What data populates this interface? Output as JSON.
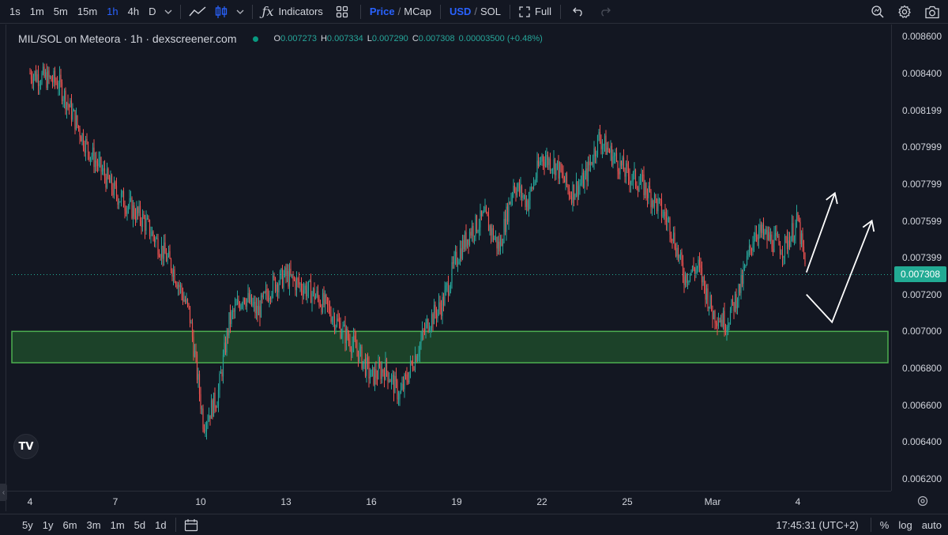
{
  "toolbar": {
    "intervals": [
      "1s",
      "1m",
      "5m",
      "15m",
      "1h",
      "4h",
      "D"
    ],
    "active_interval": "1h",
    "indicators_label": "Indicators",
    "price_label": "Price",
    "mcap_label": "MCap",
    "usd_label": "USD",
    "sol_label": "SOL",
    "slash": "/",
    "full_label": "Full"
  },
  "legend": {
    "title": "MIL/SOL on Meteora · 1h · dexscreener.com",
    "o_key": "O",
    "o_val": "0.007273",
    "h_key": "H",
    "h_val": "0.007334",
    "l_key": "L",
    "l_val": "0.007290",
    "c_key": "C",
    "c_val": "0.007308",
    "change": "0.00003500 (+0.48%)"
  },
  "bottom_bar": {
    "ranges": [
      "5y",
      "1y",
      "6m",
      "3m",
      "1m",
      "5d",
      "1d"
    ],
    "clock": "17:45:31 (UTC+2)",
    "percent_label": "%",
    "log_label": "log",
    "auto_label": "auto"
  },
  "colors": {
    "background": "#131722",
    "up": "#26a69a",
    "down": "#ef5350",
    "zone_fill": "#1f4a2a",
    "zone_border": "#4caf50",
    "price_tag": "#22ab94"
  },
  "chart_data": {
    "type": "candlestick",
    "pair": "MIL/SOL",
    "interval": "1h",
    "price_axis_ticks": [
      "0.008600",
      "0.008400",
      "0.008199",
      "0.007999",
      "0.007799",
      "0.007599",
      "0.007399",
      "0.007200",
      "0.007000",
      "0.006800",
      "0.006600",
      "0.006400",
      "0.006200"
    ],
    "ylim": [
      0.0062,
      0.0086
    ],
    "time_axis_ticks": [
      "4",
      "7",
      "10",
      "13",
      "16",
      "19",
      "22",
      "25",
      "Mar",
      "4"
    ],
    "last_price": "0.007308",
    "support_zone": [
      0.00683,
      0.007
    ],
    "price_path": [
      [
        0,
        0.0084
      ],
      [
        1,
        0.00835
      ],
      [
        2,
        0.008
      ],
      [
        3,
        0.00775
      ],
      [
        4,
        0.0076
      ],
      [
        5,
        0.00735
      ],
      [
        5.6,
        0.0071
      ],
      [
        6.1,
        0.0065
      ],
      [
        6.6,
        0.00665
      ],
      [
        7,
        0.00705
      ],
      [
        7.5,
        0.0072
      ],
      [
        8,
        0.0071
      ],
      [
        8.5,
        0.00725
      ],
      [
        9,
        0.0073
      ],
      [
        9.5,
        0.00725
      ],
      [
        10,
        0.0072
      ],
      [
        10.5,
        0.00712
      ],
      [
        11,
        0.007
      ],
      [
        11.5,
        0.0069
      ],
      [
        12,
        0.00675
      ],
      [
        12.5,
        0.0068
      ],
      [
        13,
        0.00665
      ],
      [
        13.5,
        0.00685
      ],
      [
        14,
        0.00705
      ],
      [
        14.5,
        0.00715
      ],
      [
        15,
        0.0074
      ],
      [
        15.5,
        0.00755
      ],
      [
        16,
        0.00762
      ],
      [
        16.5,
        0.00745
      ],
      [
        17,
        0.0078
      ],
      [
        17.5,
        0.0077
      ],
      [
        18,
        0.00795
      ],
      [
        18.5,
        0.0079
      ],
      [
        19,
        0.00775
      ],
      [
        19.5,
        0.00782
      ],
      [
        20,
        0.00805
      ],
      [
        20.5,
        0.00795
      ],
      [
        21,
        0.00785
      ],
      [
        21.5,
        0.0078
      ],
      [
        22,
        0.0077
      ],
      [
        22.5,
        0.00758
      ],
      [
        23,
        0.0073
      ],
      [
        23.5,
        0.00735
      ],
      [
        24,
        0.0071
      ],
      [
        24.5,
        0.00705
      ],
      [
        25,
        0.00725
      ],
      [
        25.5,
        0.00755
      ],
      [
        26,
        0.0075
      ],
      [
        26.5,
        0.00745
      ],
      [
        27,
        0.0076
      ],
      [
        27.3,
        0.0073
      ]
    ],
    "projection_path": [
      [
        27.3,
        0.00732
      ],
      [
        28.3,
        0.00775
      ]
    ],
    "projection_path_2": [
      [
        27.3,
        0.0072
      ],
      [
        28.2,
        0.00705
      ],
      [
        29.6,
        0.0076
      ]
    ]
  }
}
